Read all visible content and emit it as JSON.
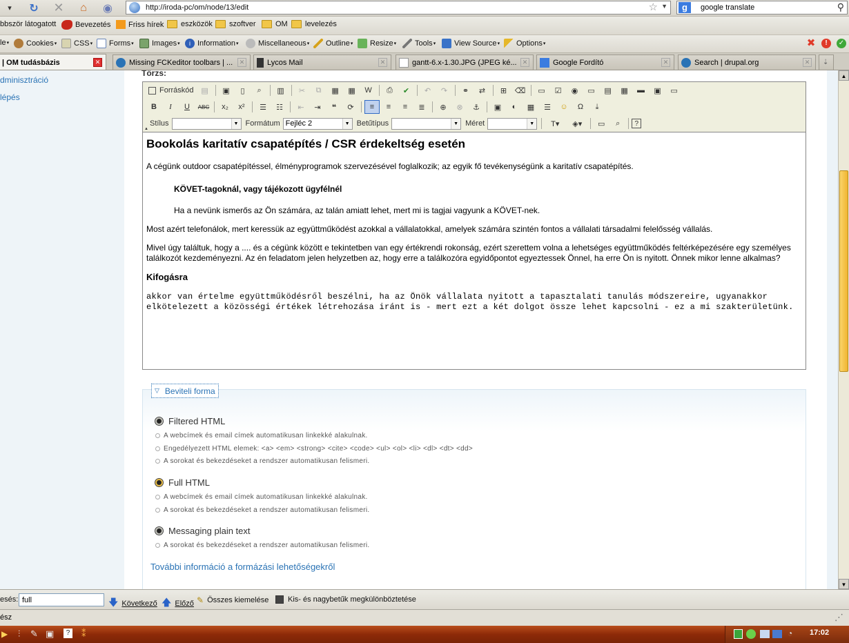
{
  "nav": {
    "url": "http://iroda-pc/om/node/13/edit",
    "search_query": "google translate"
  },
  "bookmarks": [
    {
      "label": "bbször látogatott",
      "icon": "none"
    },
    {
      "label": "Bevezetés",
      "icon": "red-bird-icon"
    },
    {
      "label": "Friss hírek",
      "icon": "rss-icon"
    },
    {
      "label": "eszközök",
      "icon": "folder-icon"
    },
    {
      "label": "szoftver",
      "icon": "folder-icon"
    },
    {
      "label": "OM",
      "icon": "folder-icon"
    },
    {
      "label": "levelezés",
      "icon": "folder-icon"
    }
  ],
  "devbar": [
    {
      "label": "le",
      "icon": "none"
    },
    {
      "label": "Cookies",
      "icon": "cookie-icon"
    },
    {
      "label": "CSS",
      "icon": "css-icon"
    },
    {
      "label": "Forms",
      "icon": "forms-icon"
    },
    {
      "label": "Images",
      "icon": "image-icon"
    },
    {
      "label": "Information",
      "icon": "info-icon"
    },
    {
      "label": "Miscellaneous",
      "icon": "misc-icon"
    },
    {
      "label": "Outline",
      "icon": "pencil-icon"
    },
    {
      "label": "Resize",
      "icon": "resize-icon"
    },
    {
      "label": "Tools",
      "icon": "wrench-icon"
    },
    {
      "label": "View Source",
      "icon": "source-icon"
    },
    {
      "label": "Options",
      "icon": "key-icon"
    }
  ],
  "tabs": [
    {
      "label": "| OM tudásbázis",
      "active": true
    },
    {
      "label": "Missing FCKeditor toolbars | ..."
    },
    {
      "label": "Lycos Mail"
    },
    {
      "label": "gantt-6.x-1.30.JPG (JPEG ké..."
    },
    {
      "label": "Google Fordító"
    },
    {
      "label": "Search | drupal.org"
    }
  ],
  "sidebar": {
    "items": [
      {
        "label": "dminisztráció"
      },
      {
        "label": "lépés"
      }
    ]
  },
  "form": {
    "body_label": "Törzs:"
  },
  "editor": {
    "source_label": "Forráskód",
    "combos": [
      {
        "label": "Stílus",
        "value": ""
      },
      {
        "label": "Formátum",
        "value": "Fejléc 2"
      },
      {
        "label": "Betűtípus",
        "value": ""
      },
      {
        "label": "Méret",
        "value": ""
      }
    ],
    "content": {
      "heading": "Bookolás karitatív csapatépítés / CSR érdekeltség esetén",
      "p1": "A cégünk outdoor csapatépítéssel, élményprogramok szervezésével foglalkozik; az egyik fő tevékenységünk a karitatív csapatépítés.",
      "indent_bold": "KÖVET-tagoknál, vagy tájékozott ügyfélnél",
      "indent_p": "Ha a nevünk ismerős az Ön számára, az talán amiatt lehet, mert mi is tagjai vagyunk a KÖVET-nek.",
      "p2": "Most azért telefonálok, mert keressük az együttműködést azokkal a vállalatokkal, amelyek számára szintén fontos a vállalati társadalmi felelősség vállalás.",
      "p3": "Mivel úgy találtuk, hogy a .... és a cégünk között e tekintetben van egy értékrendi rokonság, ezért szerettem volna a lehetséges együttműködés feltérképezésére egy személyes találkozót kezdeményezni. Az én feladatom jelen helyzetben az, hogy erre a találkozóra egyidőpontot egyeztessek Önnel, ha erre Ön is nyitott. Önnek mikor lenne alkalmas?",
      "subheading": "Kifogásra",
      "pre": "akkor van értelme együttműködésről beszélni, ha az Önök vállalata nyitott a tapasztalati tanulás módszereire, ugyanakkor elkötelezett a közösségi értékek létrehozása iránt is - mert ezt a két dolgot össze lehet kapcsolni - ez a mi szakterületünk."
    }
  },
  "input_format": {
    "legend": "Beviteli forma",
    "options": [
      {
        "label": "Filtered HTML",
        "selected": false,
        "tips": [
          "A webcímek és email címek automatikusan linkekké alakulnak.",
          "Engedélyezett HTML elemek: <a> <em> <strong> <cite> <code> <ul> <ol> <li> <dl> <dt> <dd>",
          "A sorokat és bekezdéseket a rendszer automatikusan felismeri."
        ]
      },
      {
        "label": "Full HTML",
        "selected": true,
        "tips": [
          "A webcímek és email címek automatikusan linkekké alakulnak.",
          "A sorokat és bekezdéseket a rendszer automatikusan felismeri."
        ]
      },
      {
        "label": "Messaging plain text",
        "selected": false,
        "tips": [
          "A sorokat és bekezdéseket a rendszer automatikusan felismeri."
        ]
      }
    ],
    "more_link": "További információ a formázási lehetőségekről"
  },
  "findbar": {
    "label": "esés:",
    "value": "full",
    "next": "Következő",
    "prev": "Előző",
    "highlight": "Összes kiemelése",
    "match_case": "Kis- és nagybetűk megkülönböztetése"
  },
  "status": {
    "text": "ész"
  },
  "taskbar": {
    "clock": "17:02"
  },
  "colors": {
    "link": "#2a73b5",
    "page_bg": "#ecf3f8",
    "toolbar_bg": "#efefde"
  }
}
